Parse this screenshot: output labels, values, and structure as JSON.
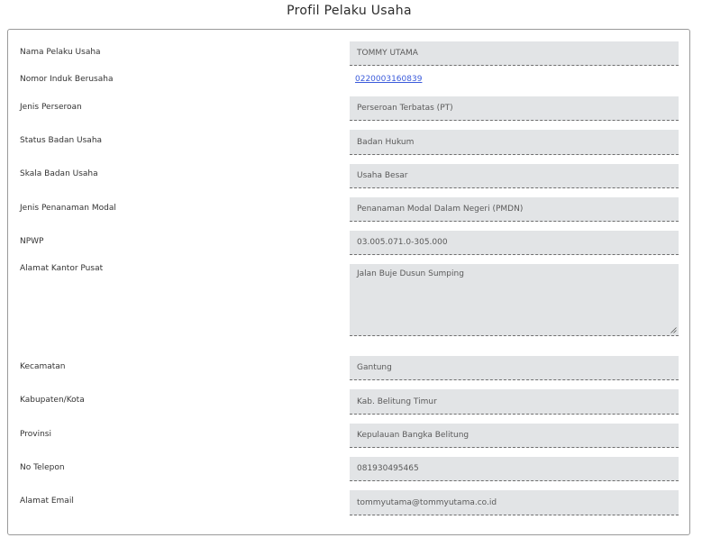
{
  "header": {
    "title": "Profil Pelaku Usaha"
  },
  "fields": {
    "nama": {
      "label": "Nama Pelaku Usaha",
      "value": "TOMMY UTAMA"
    },
    "nib": {
      "label": "Nomor Induk Berusaha",
      "value": "0220003160839"
    },
    "jenis": {
      "label": "Jenis Perseroan",
      "value": "Perseroan Terbatas (PT)"
    },
    "status": {
      "label": "Status Badan Usaha",
      "value": "Badan Hukum"
    },
    "skala": {
      "label": "Skala Badan Usaha",
      "value": "Usaha Besar"
    },
    "modal": {
      "label": "Jenis Penanaman Modal",
      "value": "Penanaman Modal Dalam Negeri (PMDN)"
    },
    "npwp": {
      "label": "NPWP",
      "value": "03.005.071.0-305.000"
    },
    "alamat": {
      "label": "Alamat Kantor Pusat",
      "value": "Jalan Buje Dusun Sumping"
    },
    "kecamatan": {
      "label": "Kecamatan",
      "value": "Gantung"
    },
    "kabupaten": {
      "label": "Kabupaten/Kota",
      "value": "Kab. Belitung Timur"
    },
    "provinsi": {
      "label": "Provinsi",
      "value": "Kepulauan Bangka Belitung"
    },
    "telepon": {
      "label": "No Telepon",
      "value": "081930495465"
    },
    "email": {
      "label": "Alamat Email",
      "value": "tommyutama@tommyutama.co.id"
    }
  }
}
